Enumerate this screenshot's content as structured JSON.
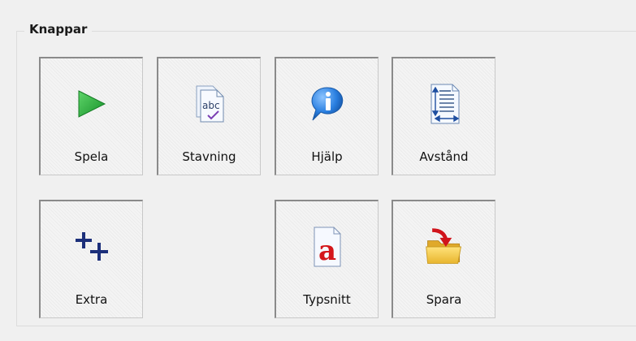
{
  "group": {
    "title": "Knappar"
  },
  "buttons": {
    "spela": {
      "label": "Spela",
      "icon": "play-icon"
    },
    "stavning": {
      "label": "Stavning",
      "icon": "spellcheck-icon"
    },
    "hjalp": {
      "label": "Hjälp",
      "icon": "info-icon"
    },
    "avstand": {
      "label": "Avstånd",
      "icon": "line-spacing-icon"
    },
    "extra": {
      "label": "Extra",
      "icon": "plus-plus-icon"
    },
    "typsnitt": {
      "label": "Typsnitt",
      "icon": "font-icon"
    },
    "spara": {
      "label": "Spara",
      "icon": "save-folder-icon"
    }
  },
  "colors": {
    "background": "#f0f0f0",
    "play_green": "#22a833",
    "info_blue": "#1f6fd0",
    "font_red": "#d4161a",
    "extra_navy": "#1c2f7a",
    "folder_yellow": "#f2c744"
  }
}
